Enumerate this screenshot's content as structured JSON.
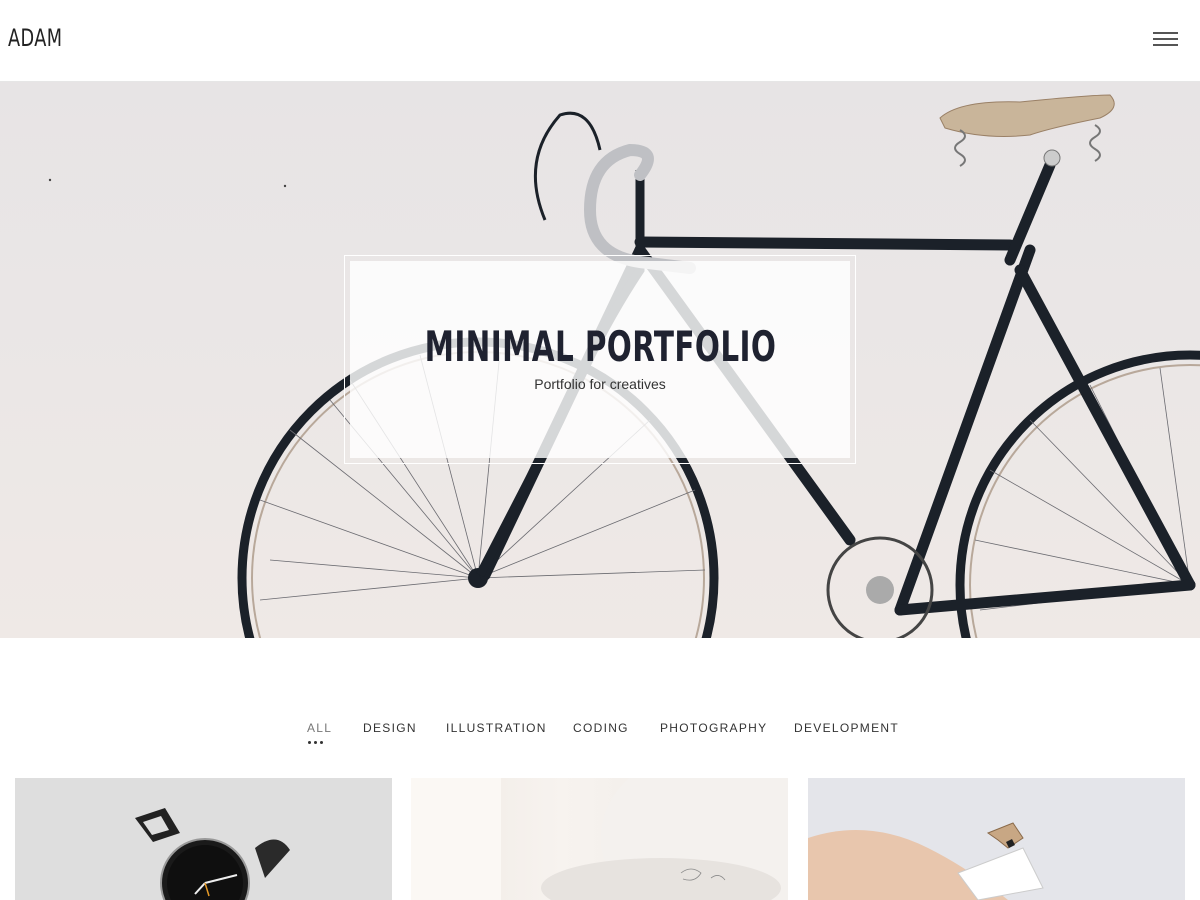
{
  "header": {
    "logo": "ADAM",
    "menu_icon": "hamburger-menu-icon"
  },
  "hero": {
    "title": "MINIMAL PORTFOLIO",
    "subtitle": "Portfolio for creatives",
    "image": "bicycle-photo"
  },
  "filters": {
    "items": [
      {
        "label": "ALL",
        "active": true
      },
      {
        "label": "DESIGN",
        "active": false
      },
      {
        "label": "ILLUSTRATION",
        "active": false
      },
      {
        "label": "CODING",
        "active": false
      },
      {
        "label": "PHOTOGRAPHY",
        "active": false
      },
      {
        "label": "DEVELOPMENT",
        "active": false
      }
    ]
  },
  "portfolio": {
    "items": [
      {
        "image": "watch-photo"
      },
      {
        "image": "chair-photo"
      },
      {
        "image": "pencil-sharpener-photo"
      }
    ]
  },
  "colors": {
    "text": "#222222",
    "hero_bg": "#e9e6e6",
    "bike_frame": "#1b2129"
  }
}
